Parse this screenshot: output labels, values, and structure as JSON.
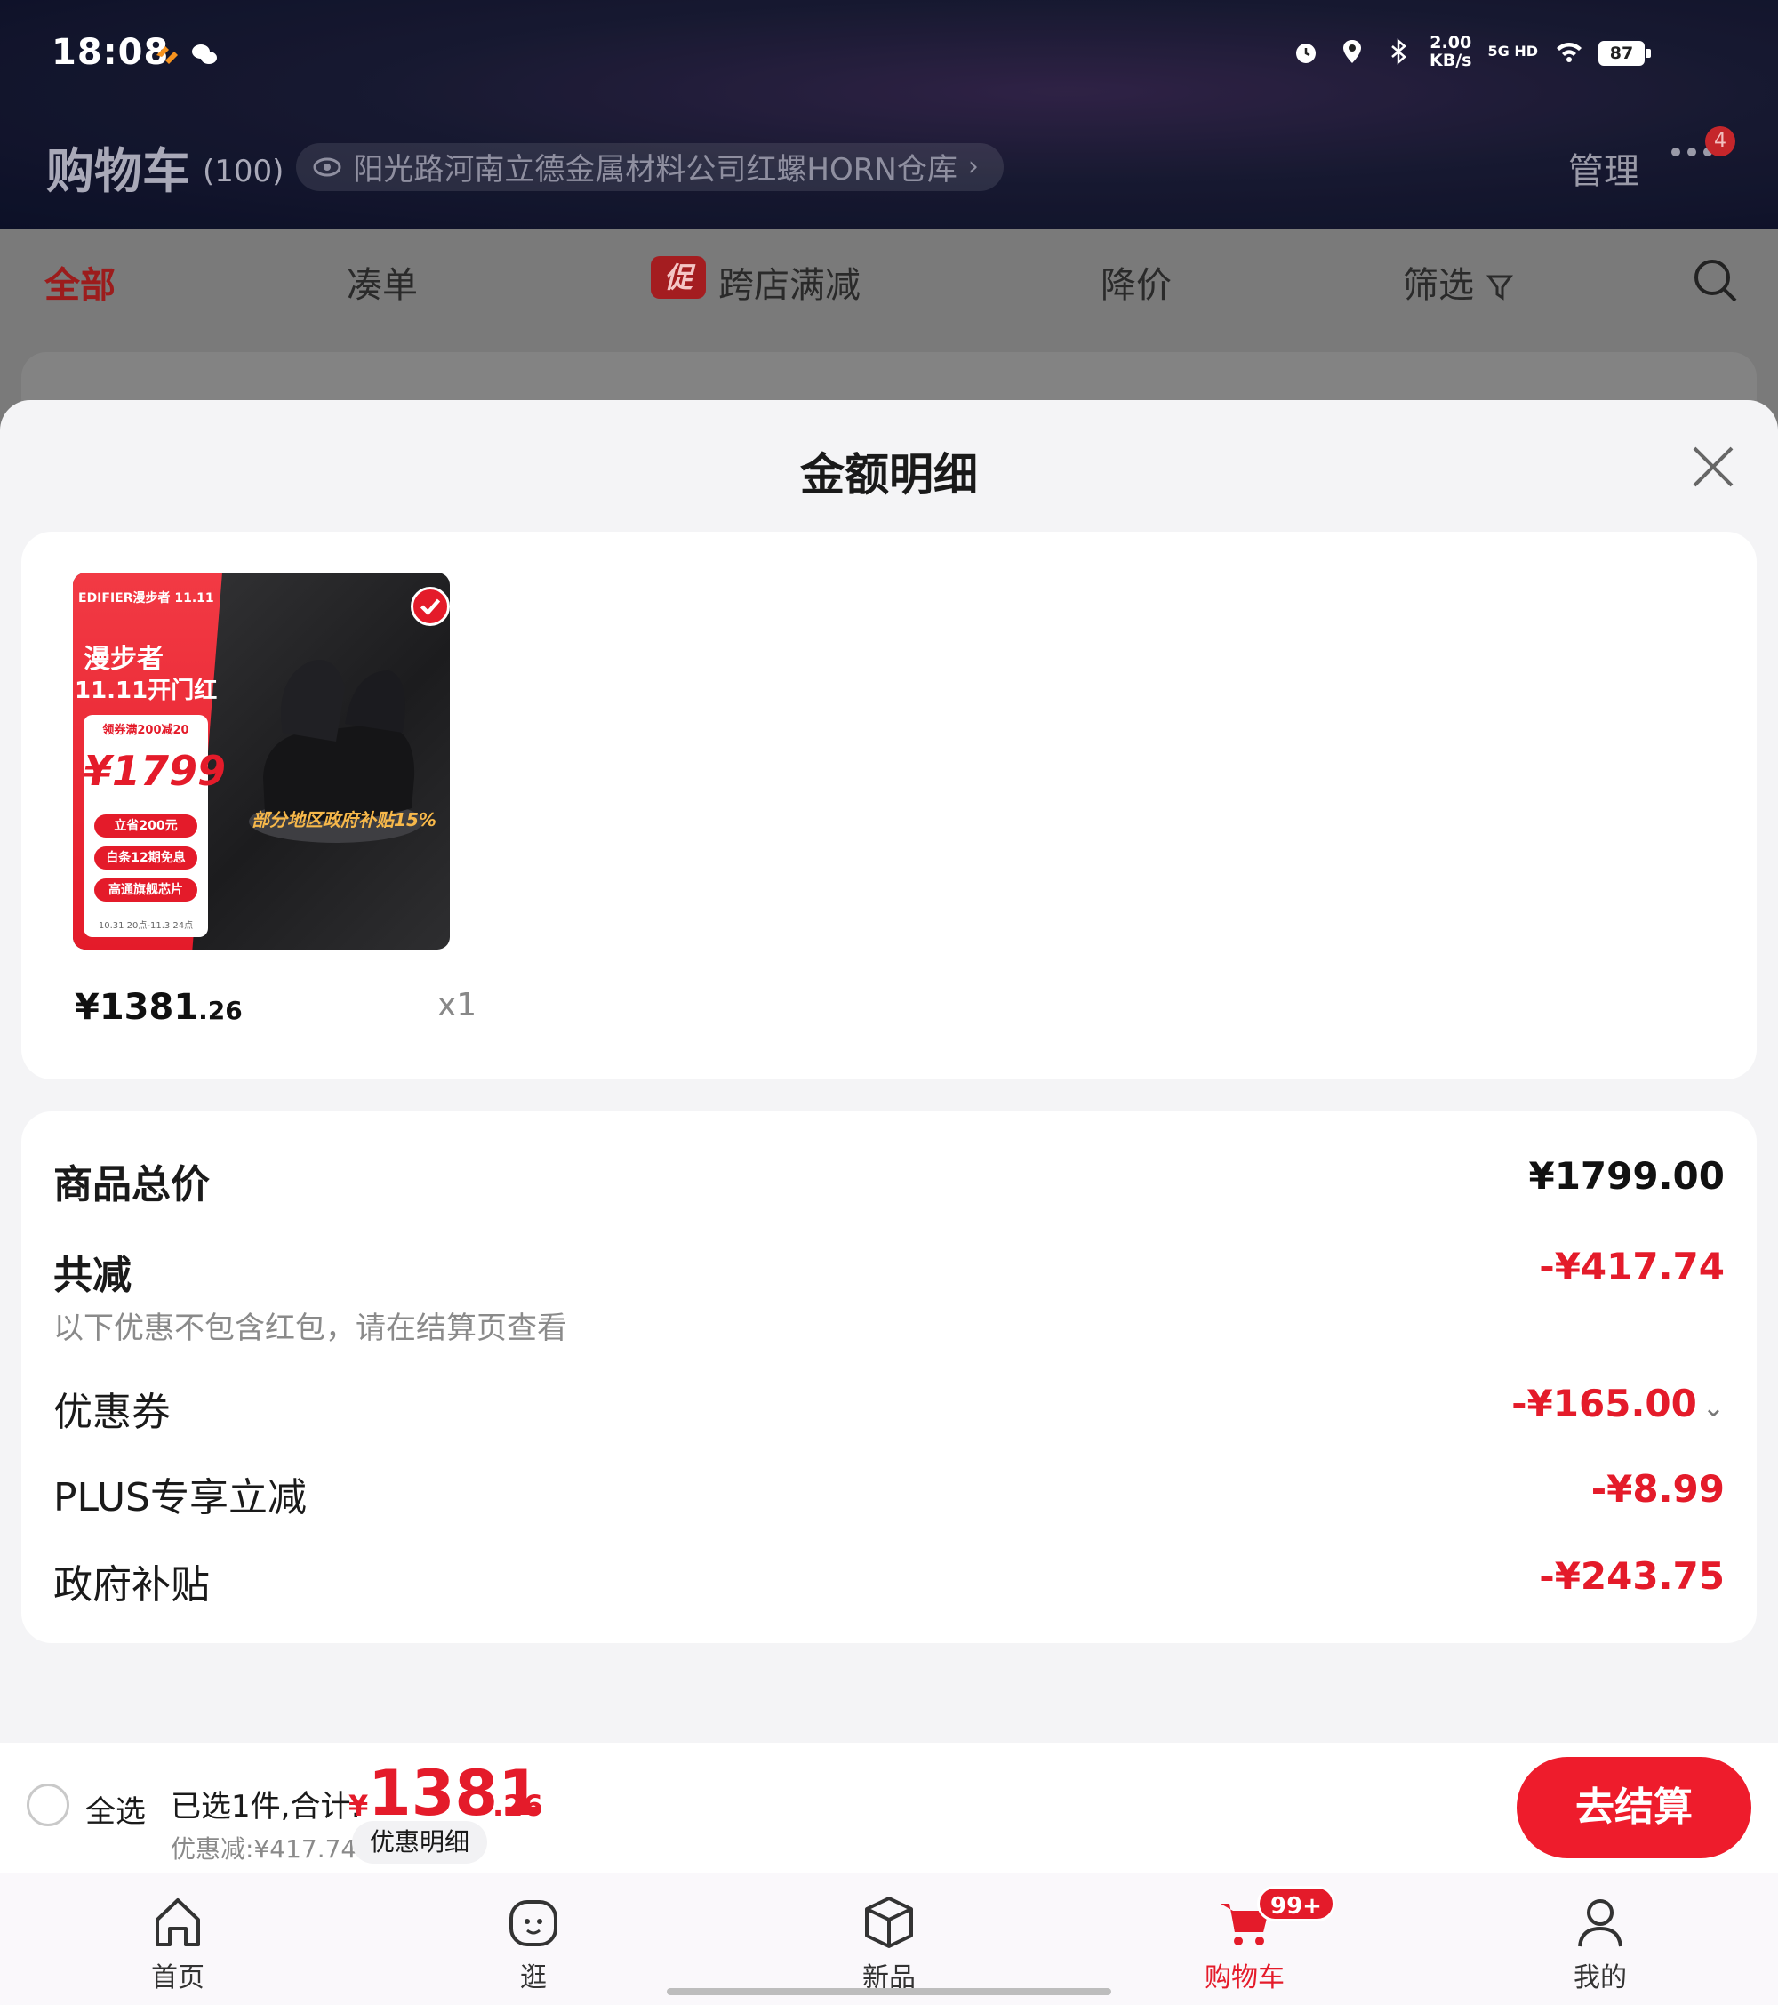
{
  "status_bar": {
    "time": "18:08",
    "net_speed_value": "2.00",
    "net_speed_unit": "KB/s",
    "network": "5G HD",
    "battery": "87"
  },
  "header": {
    "title": "购物车",
    "count": "(100)",
    "address": "阳光路河南立德金属材料公司红螺HORN仓库",
    "manage": "管理",
    "more_badge": "4"
  },
  "tabs": [
    {
      "label": "全部"
    },
    {
      "label": "凑单"
    },
    {
      "label": "跨店满减",
      "tag": "促"
    },
    {
      "label": "降价"
    },
    {
      "label": "筛选"
    }
  ],
  "sheet": {
    "title": "金额明细",
    "product": {
      "price_int": "¥1381",
      "price_dec": ".26",
      "qty": "x1",
      "image_text": {
        "brand": "EDIFIER漫步者 11.11",
        "headline1": "漫步者",
        "headline2": "11.11开门红",
        "coupon": "领券满200减20",
        "price": "¥1799",
        "pill1": "立省200元",
        "pill2": "白条12期免息",
        "pill3": "高通旗舰芯片",
        "date": "10.31 20点-11.3 24点",
        "banner": "部分地区政府补贴15%"
      }
    },
    "summary": {
      "total_label": "商品总价",
      "total_value": "¥1799.00",
      "discount_label": "共减",
      "discount_value": "-¥417.74",
      "discount_note": "以下优惠不包含红包，请在结算页查看",
      "coupon_label": "优惠券",
      "coupon_value": "-¥165.00",
      "plus_label": "PLUS专享立减",
      "plus_value": "-¥8.99",
      "gov_label": "政府补贴",
      "gov_value": "-¥243.75"
    }
  },
  "checkout": {
    "select_all": "全选",
    "selected_text": "已选1件,合计:",
    "total_yen": "¥",
    "total_int": "1381",
    "total_dec": ".26",
    "discount_text": "优惠减:¥417.74",
    "detail_button": "优惠明细",
    "checkout_button": "去结算"
  },
  "nav": [
    {
      "label": "首页",
      "icon": "home-icon"
    },
    {
      "label": "逛",
      "icon": "explore-icon"
    },
    {
      "label": "新品",
      "icon": "new-products-icon"
    },
    {
      "label": "购物车",
      "icon": "cart-icon",
      "badge": "99+"
    },
    {
      "label": "我的",
      "icon": "profile-icon"
    }
  ],
  "colors": {
    "accent": "#e41b2a",
    "sheet_bg": "#f4f4f6",
    "overlay": "#7a7a7a"
  }
}
